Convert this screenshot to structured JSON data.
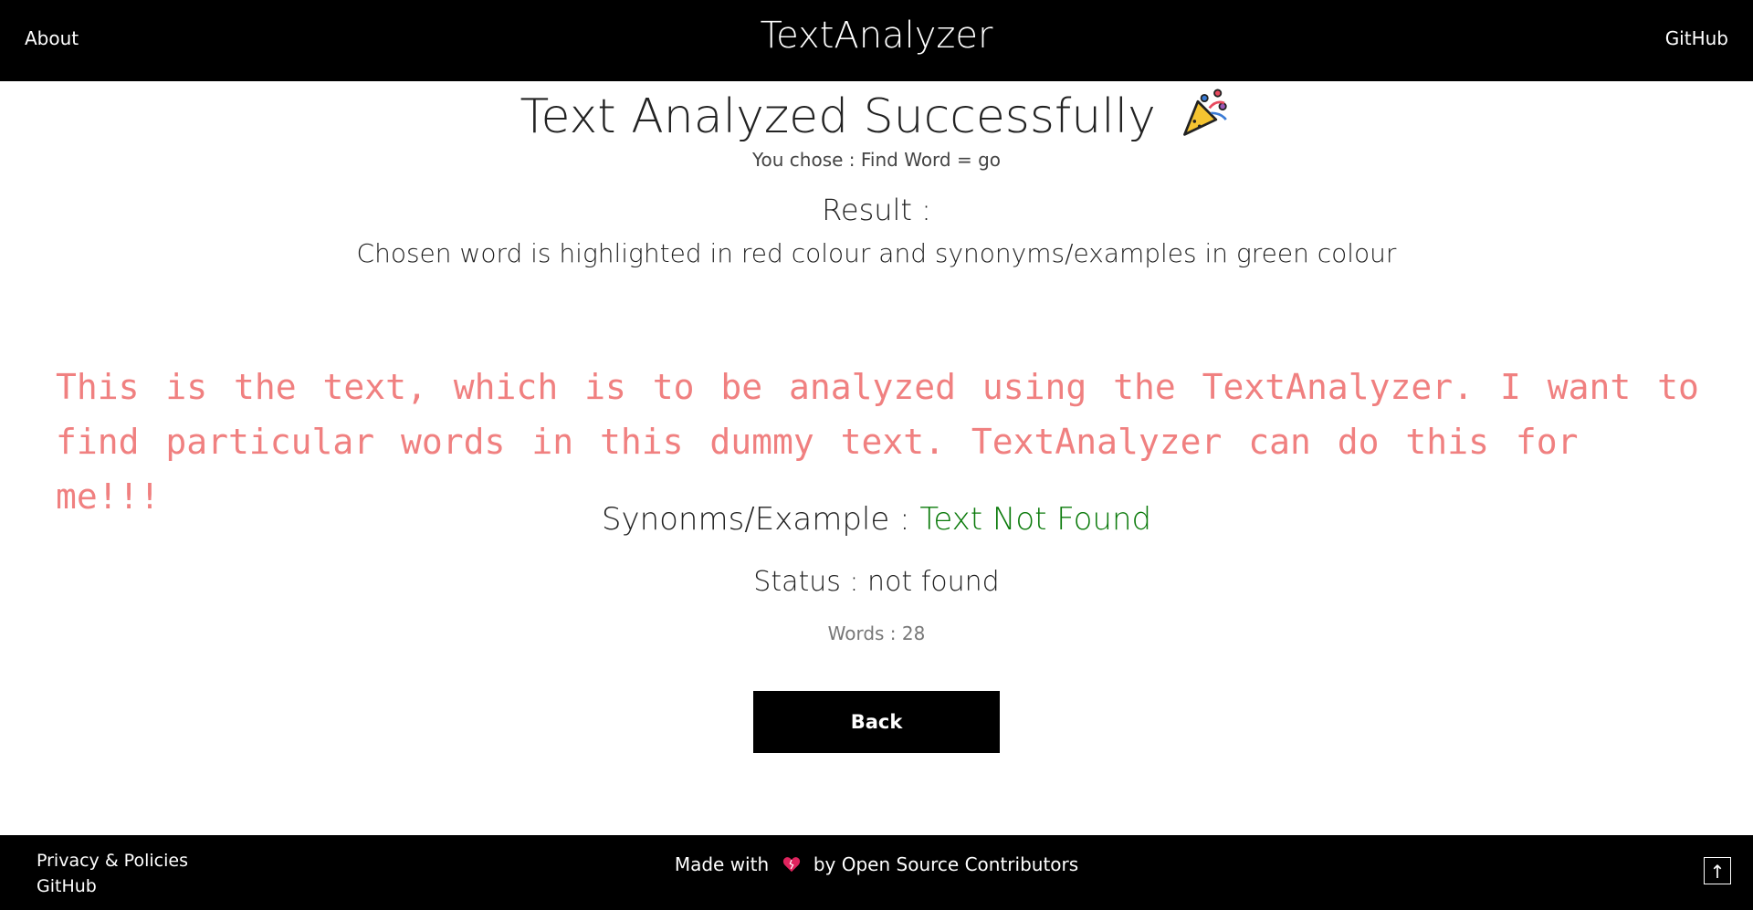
{
  "nav": {
    "brand": "TextAnalyzer",
    "about": "About",
    "github": "GitHub"
  },
  "main": {
    "heading": "Text Analyzed Successfully",
    "chose": "You chose : Find Word = go",
    "result_label": "Result :",
    "result_desc": "Chosen word is highlighted in red colour and synonyms/examples in green colour",
    "analyzed_text": "This is the text, which is to be analyzed using the TextAnalyzer. I want to find particular words in this dummy text. TextAnalyzer can do this for me!!!",
    "synonyms_label": "Synonms/Example : ",
    "synonyms_value": "Text Not Found",
    "status": "Status : not found",
    "words": "Words : 28",
    "back_label": "Back"
  },
  "footer": {
    "privacy": "Privacy & Policies",
    "github": "GitHub",
    "made_with_prefix": "Made with",
    "made_with_suffix": "by Open Source Contributors",
    "top_arrow": "↑"
  },
  "colors": {
    "nav_bg": "#000000",
    "analyzed_text": "#f08080",
    "synonyms_value": "#0a7a0a"
  },
  "icons": {
    "heading_icon": "party-popper-icon",
    "footer_icon": "heart-icon"
  }
}
